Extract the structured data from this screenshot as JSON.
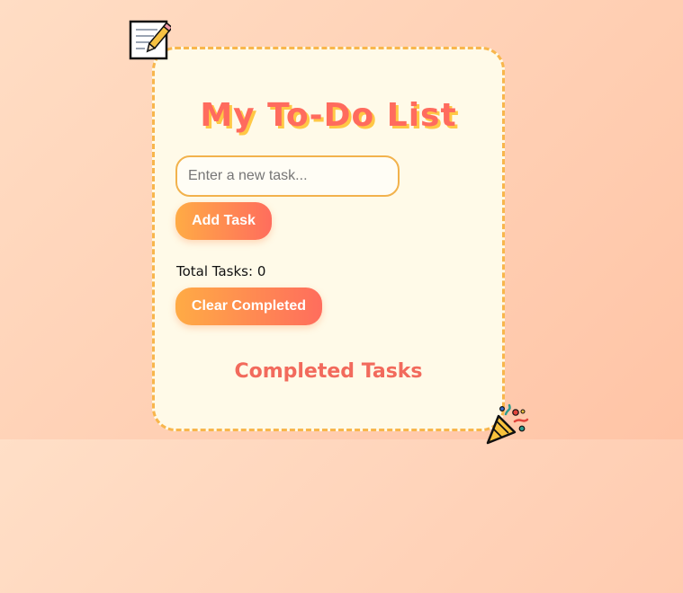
{
  "app": {
    "title": "My To-Do List"
  },
  "new_task": {
    "placeholder": "Enter a new task...",
    "value": ""
  },
  "buttons": {
    "add_label": "Add Task",
    "clear_label": "Clear Completed"
  },
  "stats": {
    "total_label": "Total Tasks:",
    "total_count": "0"
  },
  "completed": {
    "heading": "Completed Tasks"
  },
  "icons": {
    "memo": "memo-icon",
    "party": "party-popper-icon"
  },
  "colors": {
    "accent": "#ff6b5e",
    "title_shadow": "#ffc845",
    "border": "#f8b64c",
    "card_bg": "#fffae8",
    "button_start": "#ffab45",
    "button_end": "#ff6d5d"
  }
}
